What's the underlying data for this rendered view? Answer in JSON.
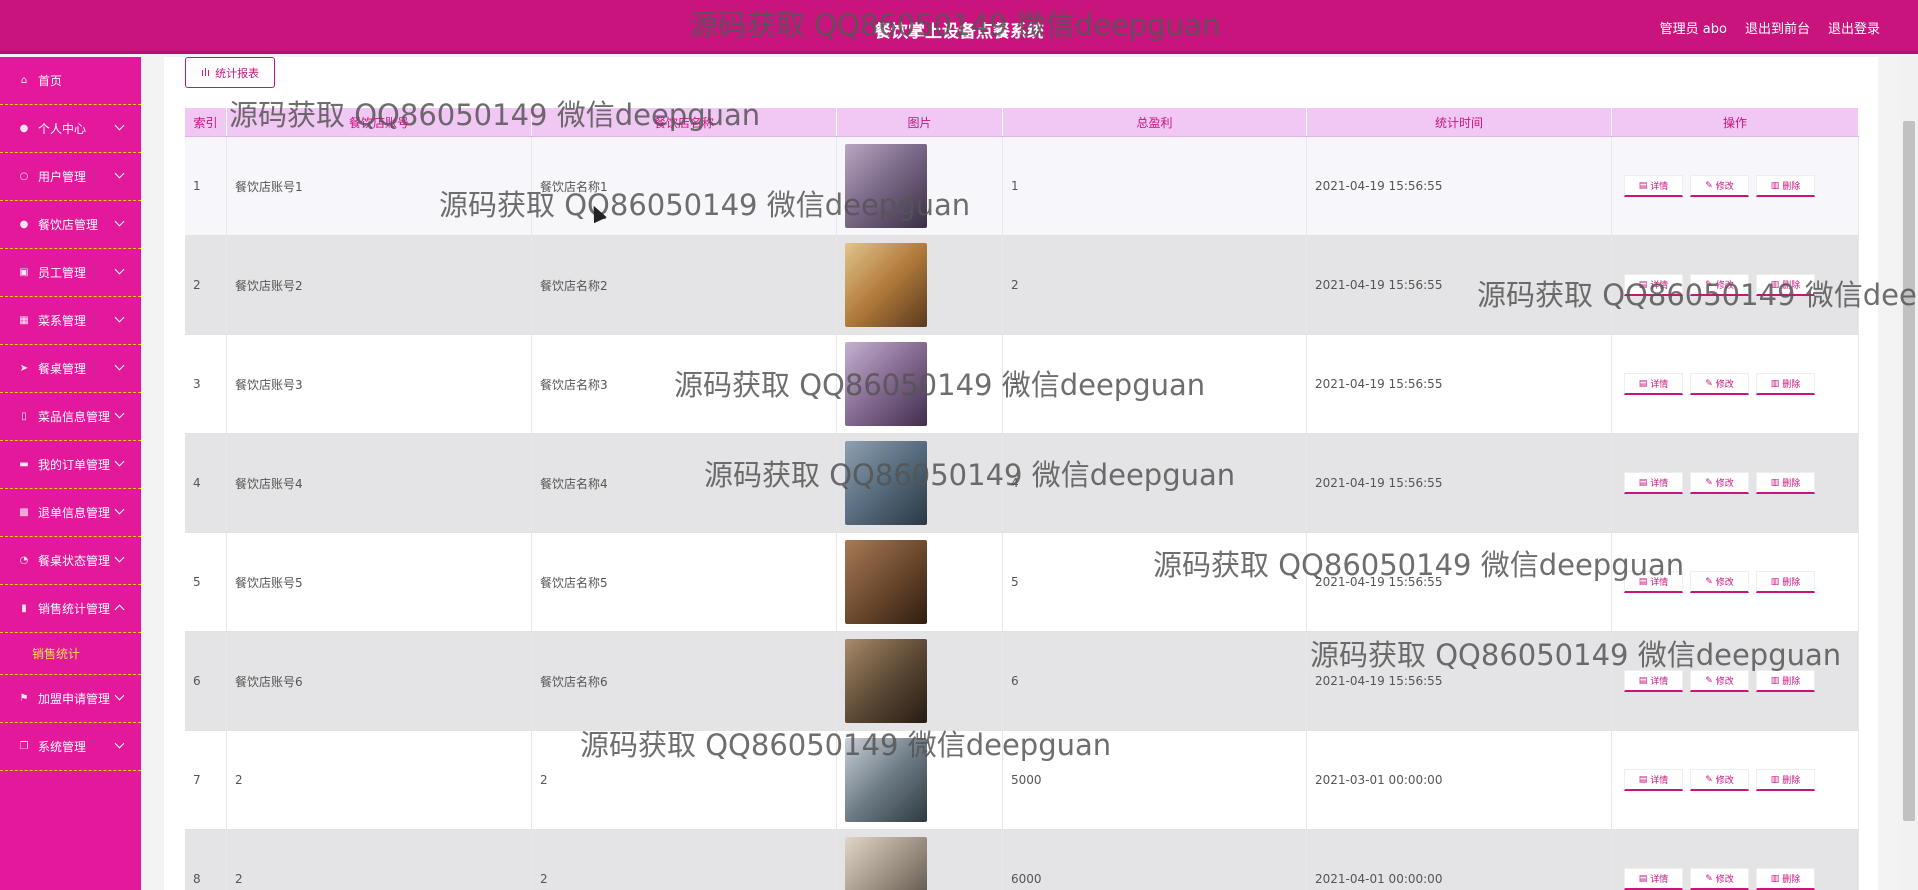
{
  "header": {
    "title": "餐饮掌上设备点餐系统",
    "user": "管理员 abo",
    "to_front": "退出到前台",
    "logout": "退出登录"
  },
  "sidebar": {
    "items": [
      {
        "label": "首页",
        "icon": "home-icon"
      },
      {
        "label": "个人中心",
        "icon": "user-icon"
      },
      {
        "label": "用户管理",
        "icon": "power-icon"
      },
      {
        "label": "餐饮店管理",
        "icon": "location-icon"
      },
      {
        "label": "员工管理",
        "icon": "list-icon"
      },
      {
        "label": "菜系管理",
        "icon": "grid-icon"
      },
      {
        "label": "餐桌管理",
        "icon": "send-icon"
      },
      {
        "label": "菜品信息管理",
        "icon": "phone-icon"
      },
      {
        "label": "我的订单管理",
        "icon": "printer-icon"
      },
      {
        "label": "退单信息管理",
        "icon": "apps-icon"
      },
      {
        "label": "餐桌状态管理",
        "icon": "gauge-icon"
      },
      {
        "label": "销售统计管理",
        "icon": "chart-icon"
      },
      {
        "label": "加盟申请管理",
        "icon": "flag-icon"
      },
      {
        "label": "系统管理",
        "icon": "copy-icon"
      }
    ],
    "submenu": "销售统计"
  },
  "report_button": "统计报表",
  "table": {
    "headers": [
      "索引",
      "餐饮店账号",
      "餐饮店名称",
      "图片",
      "总盈利",
      "统计时间",
      "操作"
    ],
    "rows": [
      {
        "idx": "1",
        "account": "餐饮店账号1",
        "name": "餐饮店名称1",
        "profit": "1",
        "time": "2021-04-19 15:56:55"
      },
      {
        "idx": "2",
        "account": "餐饮店账号2",
        "name": "餐饮店名称2",
        "profit": "2",
        "time": "2021-04-19 15:56:55"
      },
      {
        "idx": "3",
        "account": "餐饮店账号3",
        "name": "餐饮店名称3",
        "profit": "3",
        "time": "2021-04-19 15:56:55"
      },
      {
        "idx": "4",
        "account": "餐饮店账号4",
        "name": "餐饮店名称4",
        "profit": "4",
        "time": "2021-04-19 15:56:55"
      },
      {
        "idx": "5",
        "account": "餐饮店账号5",
        "name": "餐饮店名称5",
        "profit": "5",
        "time": "2021-04-19 15:56:55"
      },
      {
        "idx": "6",
        "account": "餐饮店账号6",
        "name": "餐饮店名称6",
        "profit": "6",
        "time": "2021-04-19 15:56:55"
      },
      {
        "idx": "7",
        "account": "2",
        "name": "2",
        "profit": "5000",
        "time": "2021-03-01 00:00:00"
      },
      {
        "idx": "8",
        "account": "2",
        "name": "2",
        "profit": "6000",
        "time": "2021-04-01 00:00:00"
      }
    ],
    "ops": {
      "detail": "详情",
      "edit": "修改",
      "delete": "删除"
    }
  },
  "watermark": "源码获取 QQ86050149 微信deepguan",
  "colors": {
    "primary": "#c9147e",
    "sidebar": "#e4189a",
    "header_row": "#f1c8f3",
    "accent_yellow": "#ffe24a"
  }
}
